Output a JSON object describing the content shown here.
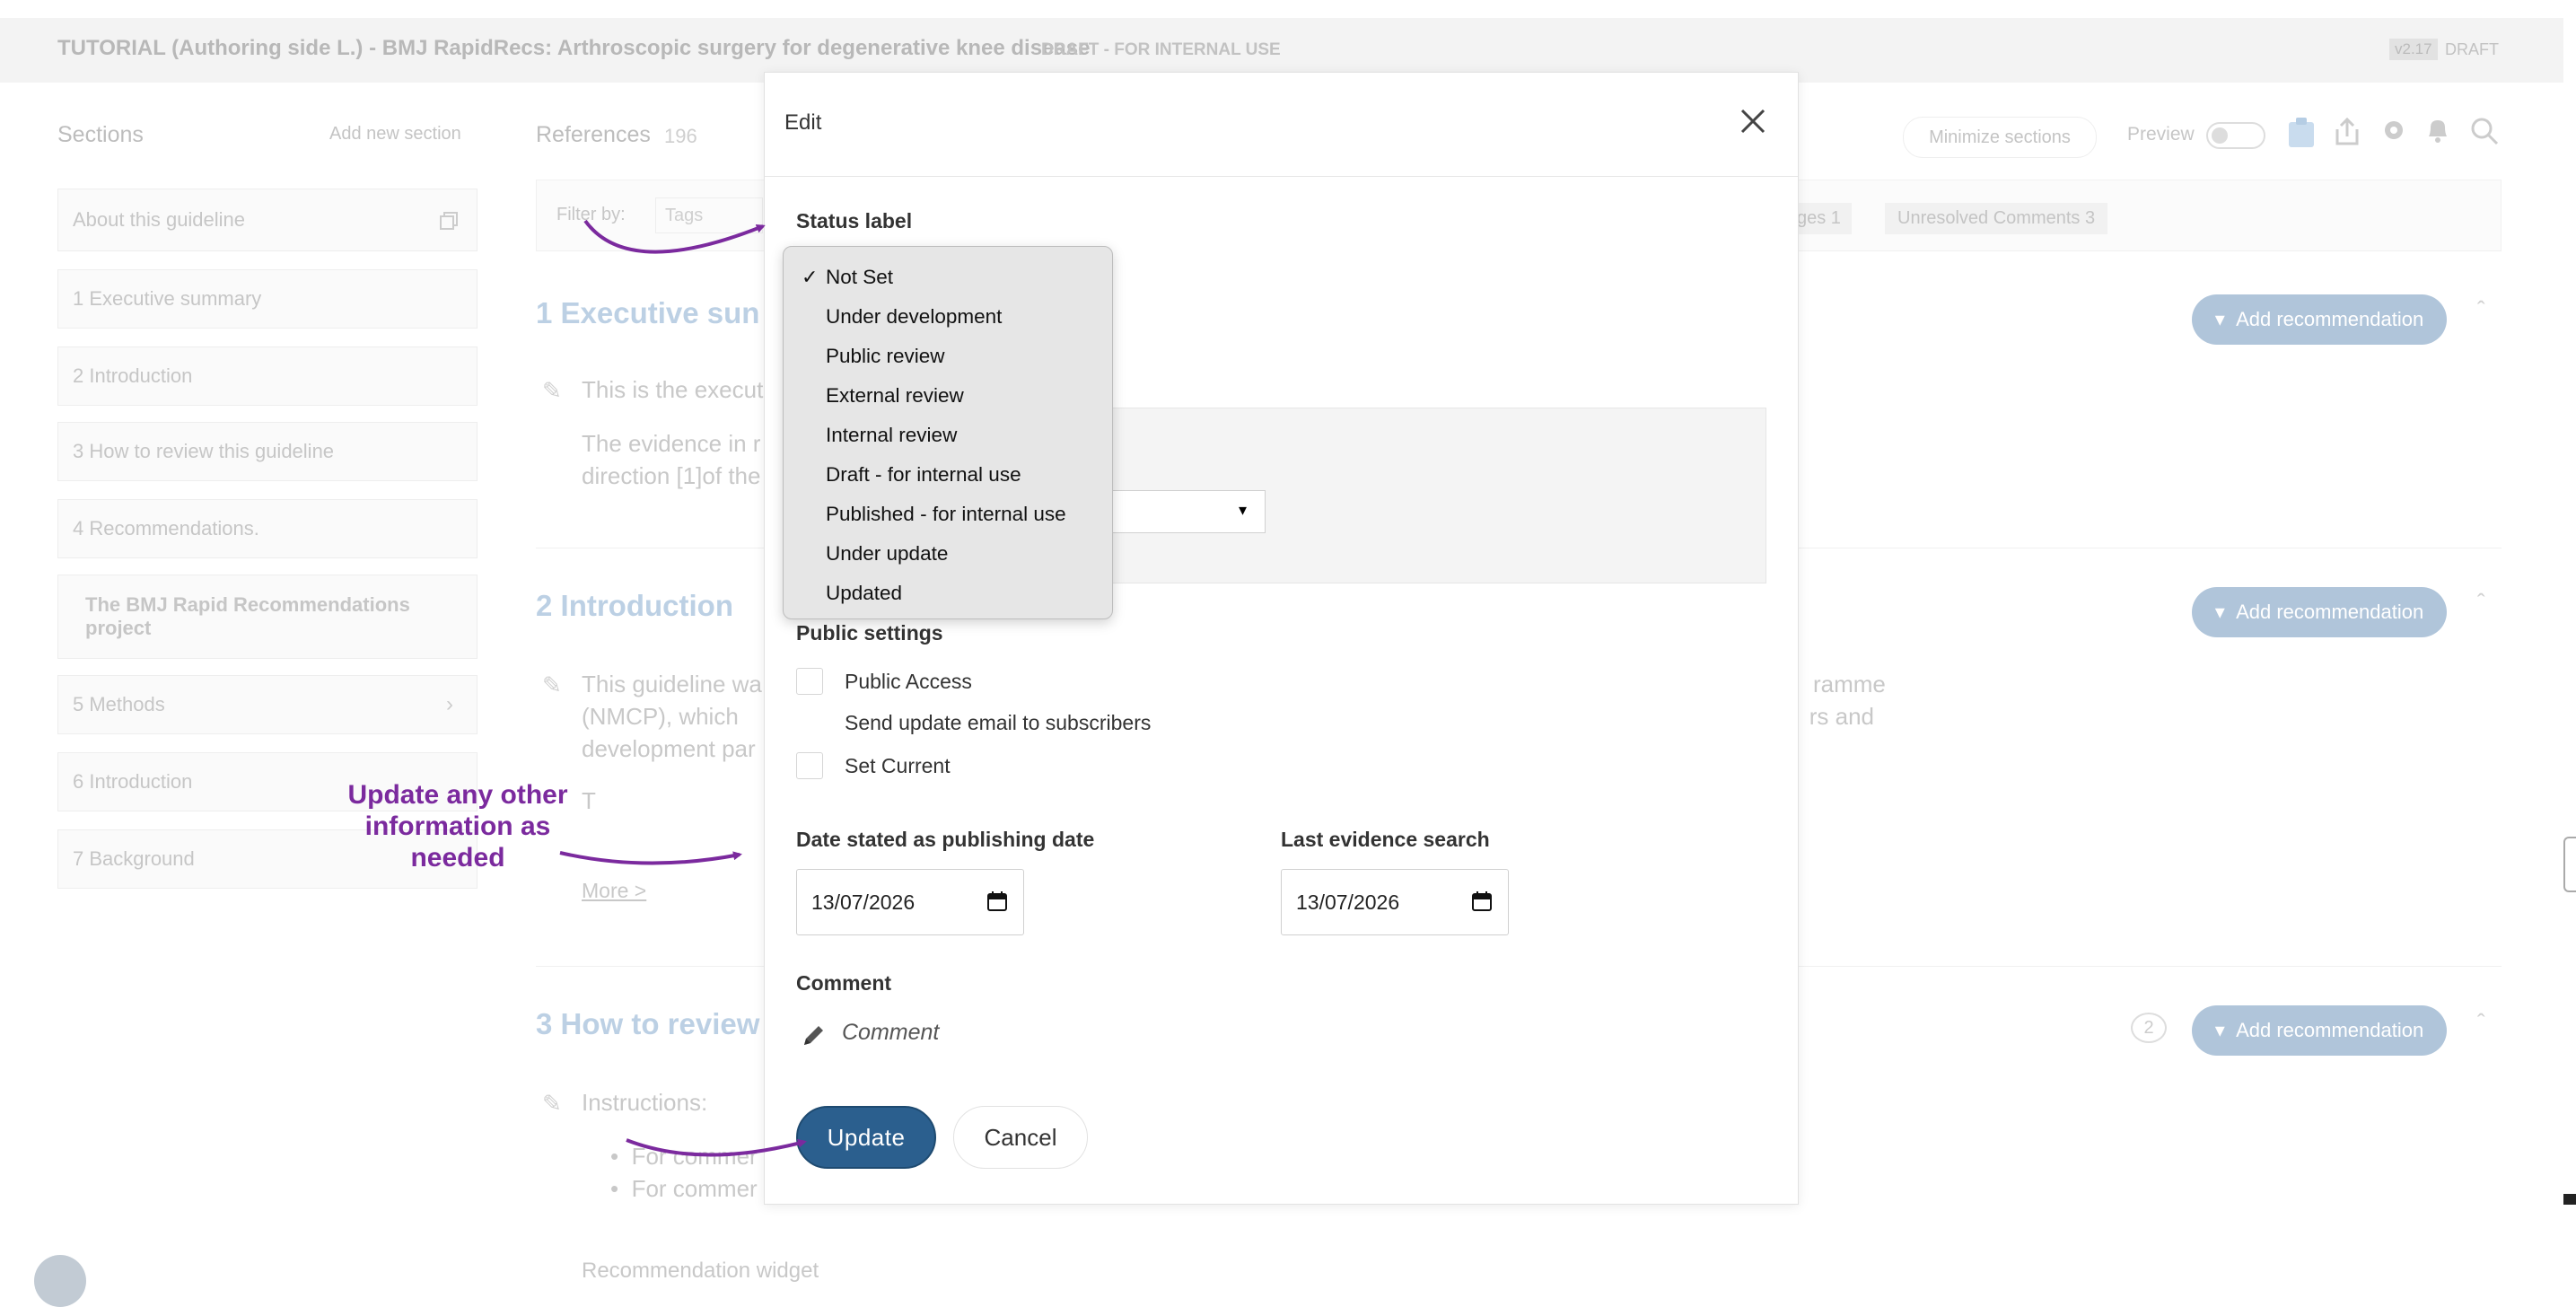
{
  "header": {
    "title": "TUTORIAL (Authoring side L.) - BMJ RapidRecs: Arthroscopic surgery for degenerative knee disease",
    "status": "DRAFT - FOR INTERNAL USE",
    "version": "v2.17",
    "version_status": "DRAFT"
  },
  "sidebar": {
    "heading": "Sections",
    "add_label": "Add new section",
    "items": [
      {
        "label": "About this guideline"
      },
      {
        "label": "1  Executive summary"
      },
      {
        "label": "2  Introduction"
      },
      {
        "label": "3  How to review this guideline"
      },
      {
        "label": "4  Recommendations."
      },
      {
        "label": "The BMJ Rapid Recommendations project"
      },
      {
        "label": "5  Methods"
      },
      {
        "label": "6  Introduction"
      },
      {
        "label": "7  Background"
      }
    ]
  },
  "content": {
    "references_label": "References",
    "references_count": "196",
    "filter_label": "Filter by:",
    "tags_placeholder": "Tags",
    "pages_chip": "ges  1",
    "unresolved_chip": "Unresolved Comments  3",
    "minimize_label": "Minimize sections",
    "preview_label": "Preview",
    "add_recommendation": "Add recommendation",
    "sections": [
      {
        "title": "1  Executive sun",
        "lines": [
          "This is the execut",
          "The evidence in r",
          "direction [1]of the"
        ]
      },
      {
        "title": "2  Introduction",
        "lines": [
          "This guideline wa",
          "(NMCP),   which",
          "development par",
          "T",
          "More >"
        ],
        "right_lines": [
          "ramme",
          "rs   and"
        ]
      },
      {
        "title": "3  How to review",
        "lines": [
          "Instructions:",
          "For commer",
          "For commer",
          "Recommendation widget"
        ],
        "comment_count": "2"
      }
    ]
  },
  "modal": {
    "title": "Edit",
    "status_label": "Status label",
    "status_options": [
      "Not Set",
      "Under development",
      "Public review",
      "External review",
      "Internal review",
      "Draft - for internal use",
      "Published - for internal use",
      "Under update",
      "Updated"
    ],
    "selected_option": "Not Set",
    "check_mark": "✓",
    "public_settings_label": "Public settings",
    "checkboxes": [
      {
        "label": "Public Access",
        "checked": false
      },
      {
        "label": "Send update email to subscribers",
        "checked": false
      },
      {
        "label": "Set Current",
        "checked": false
      }
    ],
    "publish_date_label": "Date stated as publishing date",
    "publish_date_value": "13/07/2026",
    "evidence_search_label": "Last evidence search",
    "evidence_search_value": "13/07/2026",
    "comment_label": "Comment",
    "comment_placeholder": "Comment",
    "update_label": "Update",
    "cancel_label": "Cancel"
  },
  "annotation": {
    "text": "Update any other information as needed",
    "color": "#7b2a9e"
  },
  "colors": {
    "primary_button": "#2b5f8e",
    "add_recommendation_faded": "#b0c5da"
  }
}
